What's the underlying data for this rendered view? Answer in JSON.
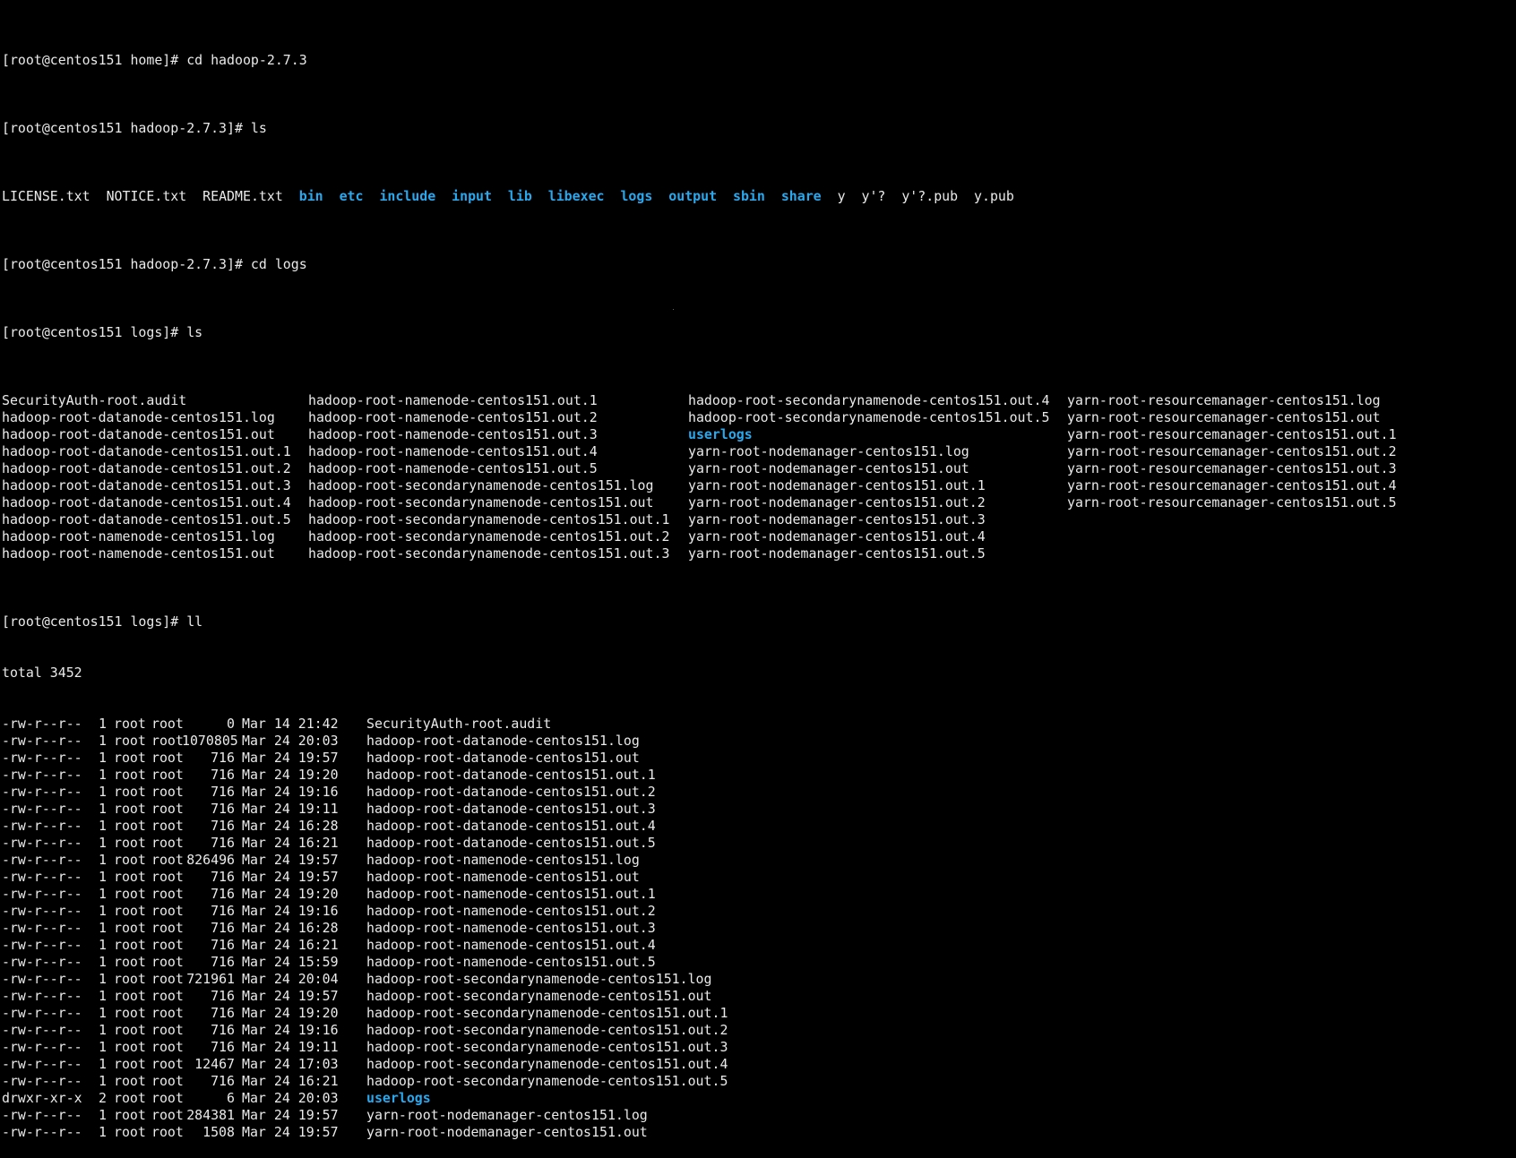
{
  "terminal": {
    "commands": [
      {
        "prompt": "[root@centos151 home]#",
        "cmd": " cd hadoop-2.7.3"
      },
      {
        "prompt": "[root@centos151 hadoop-2.7.3]#",
        "cmd": " ls"
      },
      {
        "prompt": "[root@centos151 hadoop-2.7.3]#",
        "cmd": " cd logs"
      },
      {
        "prompt": "[root@centos151 logs]#",
        "cmd": " ls"
      },
      {
        "prompt": "[root@centos151 logs]#",
        "cmd": " ll"
      }
    ],
    "hadoop_ls": [
      {
        "text": "LICENSE.txt",
        "dir": false
      },
      {
        "text": "NOTICE.txt",
        "dir": false
      },
      {
        "text": "README.txt",
        "dir": false
      },
      {
        "text": "bin",
        "dir": true
      },
      {
        "text": "etc",
        "dir": true
      },
      {
        "text": "include",
        "dir": true
      },
      {
        "text": "input",
        "dir": true
      },
      {
        "text": "lib",
        "dir": true
      },
      {
        "text": "libexec",
        "dir": true
      },
      {
        "text": "logs",
        "dir": true
      },
      {
        "text": "output",
        "dir": true
      },
      {
        "text": "sbin",
        "dir": true
      },
      {
        "text": "share",
        "dir": true
      },
      {
        "text": "y",
        "dir": false
      },
      {
        "text": "y'?",
        "dir": false
      },
      {
        "text": "y'?.pub",
        "dir": false
      },
      {
        "text": "y.pub",
        "dir": false
      }
    ],
    "logs_ls": [
      [
        "SecurityAuth-root.audit",
        "hadoop-root-namenode-centos151.out.1",
        "hadoop-root-secondarynamenode-centos151.out.4",
        "yarn-root-resourcemanager-centos151.log"
      ],
      [
        "hadoop-root-datanode-centos151.log",
        "hadoop-root-namenode-centos151.out.2",
        "hadoop-root-secondarynamenode-centos151.out.5",
        "yarn-root-resourcemanager-centos151.out"
      ],
      [
        "hadoop-root-datanode-centos151.out",
        "hadoop-root-namenode-centos151.out.3",
        "userlogs",
        "yarn-root-resourcemanager-centos151.out.1"
      ],
      [
        "hadoop-root-datanode-centos151.out.1",
        "hadoop-root-namenode-centos151.out.4",
        "yarn-root-nodemanager-centos151.log",
        "yarn-root-resourcemanager-centos151.out.2"
      ],
      [
        "hadoop-root-datanode-centos151.out.2",
        "hadoop-root-namenode-centos151.out.5",
        "yarn-root-nodemanager-centos151.out",
        "yarn-root-resourcemanager-centos151.out.3"
      ],
      [
        "hadoop-root-datanode-centos151.out.3",
        "hadoop-root-secondarynamenode-centos151.log",
        "yarn-root-nodemanager-centos151.out.1",
        "yarn-root-resourcemanager-centos151.out.4"
      ],
      [
        "hadoop-root-datanode-centos151.out.4",
        "hadoop-root-secondarynamenode-centos151.out",
        "yarn-root-nodemanager-centos151.out.2",
        "yarn-root-resourcemanager-centos151.out.5"
      ],
      [
        "hadoop-root-datanode-centos151.out.5",
        "hadoop-root-secondarynamenode-centos151.out.1",
        "yarn-root-nodemanager-centos151.out.3",
        ""
      ],
      [
        "hadoop-root-namenode-centos151.log",
        "hadoop-root-secondarynamenode-centos151.out.2",
        "yarn-root-nodemanager-centos151.out.4",
        ""
      ],
      [
        "hadoop-root-namenode-centos151.out",
        "hadoop-root-secondarynamenode-centos151.out.3",
        "yarn-root-nodemanager-centos151.out.5",
        ""
      ]
    ],
    "dir_names": [
      "userlogs"
    ],
    "total": "total 3452",
    "ll_rows": [
      {
        "perm": "-rw-r--r--",
        "links": "1",
        "owner": "root",
        "group": "root",
        "size": "0",
        "date": "Mar 14 21:42",
        "name": "SecurityAuth-root.audit",
        "dir": false
      },
      {
        "perm": "-rw-r--r--",
        "links": "1",
        "owner": "root",
        "group": "root",
        "size": "1070805",
        "date": "Mar 24 20:03",
        "name": "hadoop-root-datanode-centos151.log",
        "dir": false
      },
      {
        "perm": "-rw-r--r--",
        "links": "1",
        "owner": "root",
        "group": "root",
        "size": "716",
        "date": "Mar 24 19:57",
        "name": "hadoop-root-datanode-centos151.out",
        "dir": false
      },
      {
        "perm": "-rw-r--r--",
        "links": "1",
        "owner": "root",
        "group": "root",
        "size": "716",
        "date": "Mar 24 19:20",
        "name": "hadoop-root-datanode-centos151.out.1",
        "dir": false
      },
      {
        "perm": "-rw-r--r--",
        "links": "1",
        "owner": "root",
        "group": "root",
        "size": "716",
        "date": "Mar 24 19:16",
        "name": "hadoop-root-datanode-centos151.out.2",
        "dir": false
      },
      {
        "perm": "-rw-r--r--",
        "links": "1",
        "owner": "root",
        "group": "root",
        "size": "716",
        "date": "Mar 24 19:11",
        "name": "hadoop-root-datanode-centos151.out.3",
        "dir": false
      },
      {
        "perm": "-rw-r--r--",
        "links": "1",
        "owner": "root",
        "group": "root",
        "size": "716",
        "date": "Mar 24 16:28",
        "name": "hadoop-root-datanode-centos151.out.4",
        "dir": false
      },
      {
        "perm": "-rw-r--r--",
        "links": "1",
        "owner": "root",
        "group": "root",
        "size": "716",
        "date": "Mar 24 16:21",
        "name": "hadoop-root-datanode-centos151.out.5",
        "dir": false
      },
      {
        "perm": "-rw-r--r--",
        "links": "1",
        "owner": "root",
        "group": "root",
        "size": "826496",
        "date": "Mar 24 19:57",
        "name": "hadoop-root-namenode-centos151.log",
        "dir": false
      },
      {
        "perm": "-rw-r--r--",
        "links": "1",
        "owner": "root",
        "group": "root",
        "size": "716",
        "date": "Mar 24 19:57",
        "name": "hadoop-root-namenode-centos151.out",
        "dir": false
      },
      {
        "perm": "-rw-r--r--",
        "links": "1",
        "owner": "root",
        "group": "root",
        "size": "716",
        "date": "Mar 24 19:20",
        "name": "hadoop-root-namenode-centos151.out.1",
        "dir": false
      },
      {
        "perm": "-rw-r--r--",
        "links": "1",
        "owner": "root",
        "group": "root",
        "size": "716",
        "date": "Mar 24 19:16",
        "name": "hadoop-root-namenode-centos151.out.2",
        "dir": false
      },
      {
        "perm": "-rw-r--r--",
        "links": "1",
        "owner": "root",
        "group": "root",
        "size": "716",
        "date": "Mar 24 16:28",
        "name": "hadoop-root-namenode-centos151.out.3",
        "dir": false
      },
      {
        "perm": "-rw-r--r--",
        "links": "1",
        "owner": "root",
        "group": "root",
        "size": "716",
        "date": "Mar 24 16:21",
        "name": "hadoop-root-namenode-centos151.out.4",
        "dir": false
      },
      {
        "perm": "-rw-r--r--",
        "links": "1",
        "owner": "root",
        "group": "root",
        "size": "716",
        "date": "Mar 24 15:59",
        "name": "hadoop-root-namenode-centos151.out.5",
        "dir": false
      },
      {
        "perm": "-rw-r--r--",
        "links": "1",
        "owner": "root",
        "group": "root",
        "size": "721961",
        "date": "Mar 24 20:04",
        "name": "hadoop-root-secondarynamenode-centos151.log",
        "dir": false
      },
      {
        "perm": "-rw-r--r--",
        "links": "1",
        "owner": "root",
        "group": "root",
        "size": "716",
        "date": "Mar 24 19:57",
        "name": "hadoop-root-secondarynamenode-centos151.out",
        "dir": false
      },
      {
        "perm": "-rw-r--r--",
        "links": "1",
        "owner": "root",
        "group": "root",
        "size": "716",
        "date": "Mar 24 19:20",
        "name": "hadoop-root-secondarynamenode-centos151.out.1",
        "dir": false
      },
      {
        "perm": "-rw-r--r--",
        "links": "1",
        "owner": "root",
        "group": "root",
        "size": "716",
        "date": "Mar 24 19:16",
        "name": "hadoop-root-secondarynamenode-centos151.out.2",
        "dir": false
      },
      {
        "perm": "-rw-r--r--",
        "links": "1",
        "owner": "root",
        "group": "root",
        "size": "716",
        "date": "Mar 24 19:11",
        "name": "hadoop-root-secondarynamenode-centos151.out.3",
        "dir": false
      },
      {
        "perm": "-rw-r--r--",
        "links": "1",
        "owner": "root",
        "group": "root",
        "size": "12467",
        "date": "Mar 24 17:03",
        "name": "hadoop-root-secondarynamenode-centos151.out.4",
        "dir": false
      },
      {
        "perm": "-rw-r--r--",
        "links": "1",
        "owner": "root",
        "group": "root",
        "size": "716",
        "date": "Mar 24 16:21",
        "name": "hadoop-root-secondarynamenode-centos151.out.5",
        "dir": false
      },
      {
        "perm": "drwxr-xr-x",
        "links": "2",
        "owner": "root",
        "group": "root",
        "size": "6",
        "date": "Mar 24 20:03",
        "name": "userlogs",
        "dir": true
      },
      {
        "perm": "-rw-r--r--",
        "links": "1",
        "owner": "root",
        "group": "root",
        "size": "284381",
        "date": "Mar 24 19:57",
        "name": "yarn-root-nodemanager-centos151.log",
        "dir": false
      },
      {
        "perm": "-rw-r--r--",
        "links": "1",
        "owner": "root",
        "group": "root",
        "size": "1508",
        "date": "Mar 24 19:57",
        "name": "yarn-root-nodemanager-centos151.out",
        "dir": false
      }
    ]
  },
  "colors": {
    "background": "#000000",
    "text": "#eaeaea",
    "directory": "#2aa8ee"
  }
}
